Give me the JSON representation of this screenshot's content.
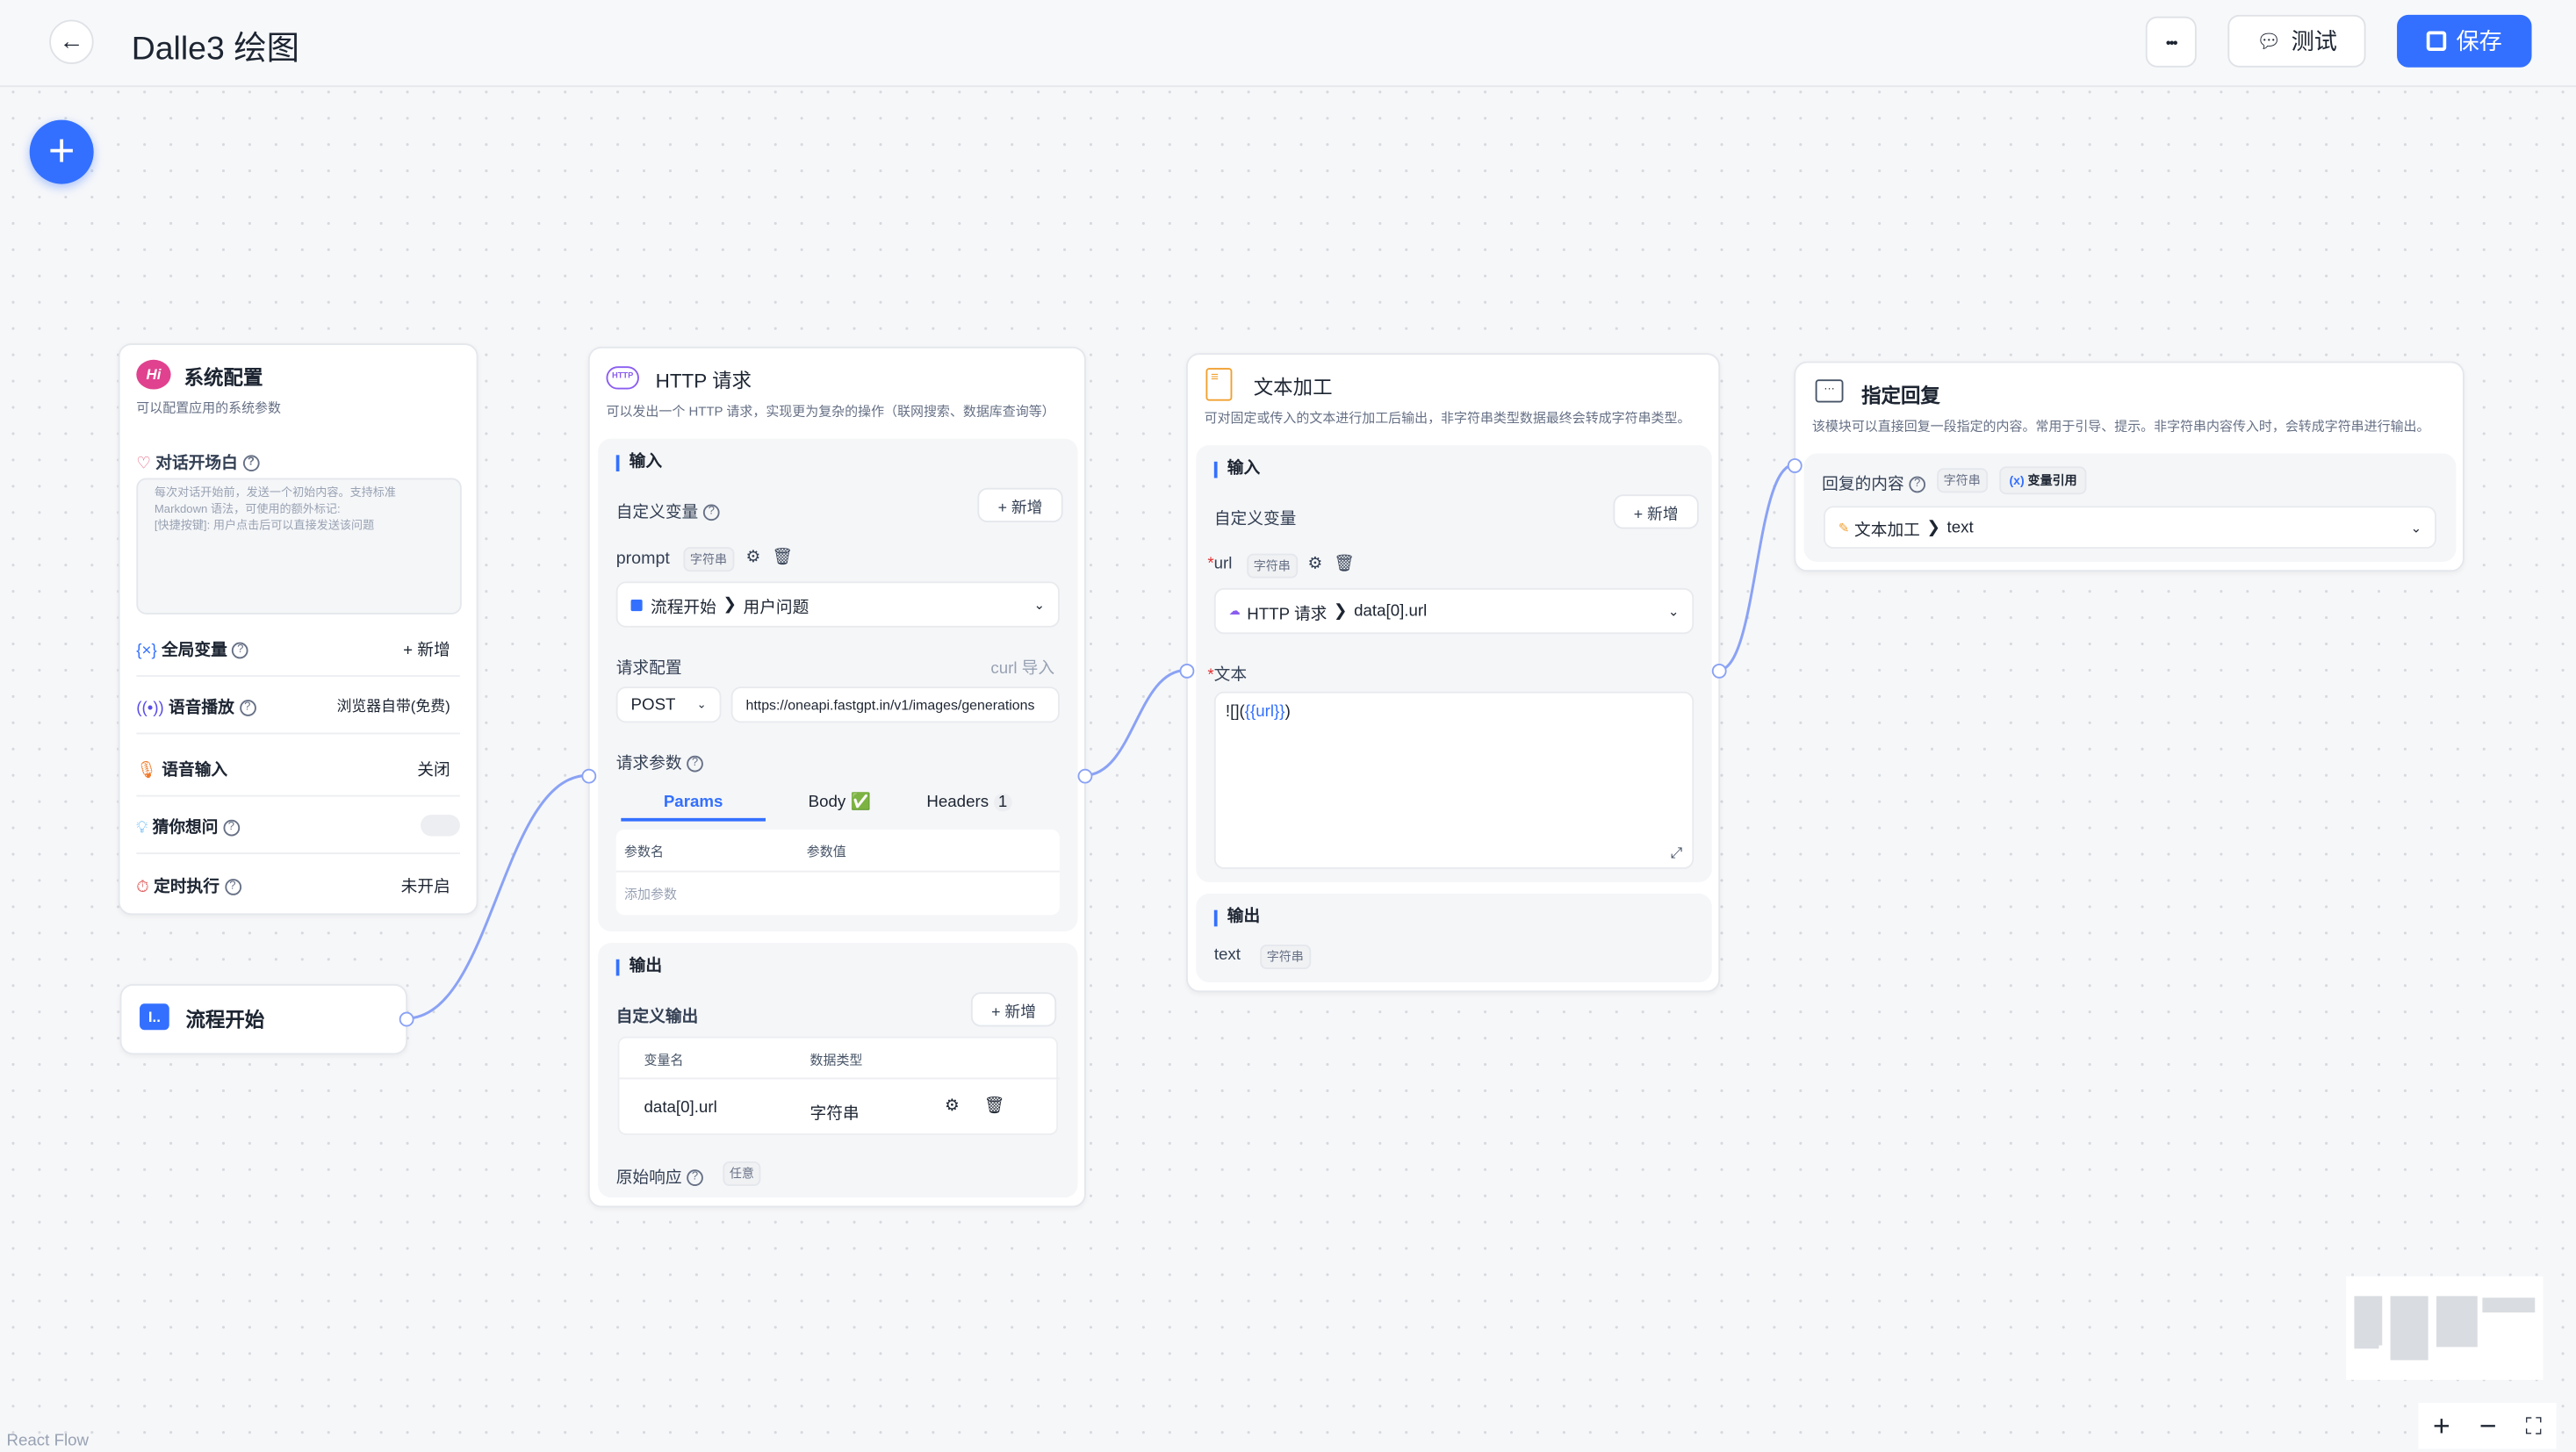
{
  "header": {
    "title": "Dalle3 绘图",
    "more_label": "•••",
    "test_label": "测试",
    "save_label": "保存"
  },
  "colors": {
    "accent": "#3370ff",
    "edge": "#8aa2f5"
  },
  "system_config": {
    "title": "系统配置",
    "desc": "可以配置应用的系统参数",
    "welcome_label": "对话开场白",
    "welcome_placeholder": "每次对话开始前，发送一个初始内容。支持标准 Markdown 语法，可使用的额外标记:\n[快捷按键]: 用户点击后可以直接发送该问题",
    "rows": [
      {
        "icon": "variable-icon",
        "label": "全局变量",
        "value": "+ 新增",
        "help": true
      },
      {
        "icon": "speaker-icon",
        "label": "语音播放",
        "value": "浏览器自带(免费)",
        "help": true
      },
      {
        "icon": "microphone-icon",
        "label": "语音输入",
        "value": "关闭",
        "help": false
      },
      {
        "icon": "lightbulb-icon",
        "label": "猜你想问",
        "value": "",
        "help": true,
        "toggle": false
      },
      {
        "icon": "timer-icon",
        "label": "定时执行",
        "value": "未开启",
        "help": true
      }
    ]
  },
  "flow_start": {
    "title": "流程开始"
  },
  "http": {
    "title": "HTTP 请求",
    "desc": "可以发出一个 HTTP 请求，实现更为复杂的操作（联网搜索、数据库查询等）",
    "input_label": "输入",
    "custom_var_label": "自定义变量",
    "add_label": "+ 新增",
    "var_name": "prompt",
    "var_type": "字符串",
    "var_source": "流程开始",
    "var_source_field": "用户问题",
    "request_config_label": "请求配置",
    "curl_import": "curl 导入",
    "method": "POST",
    "url": "https://oneapi.fastgpt.in/v1/images/generations",
    "params_label": "请求参数",
    "tabs": [
      {
        "label": "Params",
        "active": true
      },
      {
        "label": "Body ✅",
        "active": false
      },
      {
        "label": "Headers",
        "badge": "1",
        "active": false
      }
    ],
    "param_col_name": "参数名",
    "param_col_value": "参数值",
    "add_param": "添加参数",
    "output_label": "输出",
    "custom_output_label": "自定义输出",
    "out_col_name": "变量名",
    "out_col_type": "数据类型",
    "out_name": "data[0].url",
    "out_type": "字符串",
    "raw_response_label": "原始响应",
    "raw_response_type": "任意"
  },
  "text_edit": {
    "title": "文本加工",
    "desc": "可对固定或传入的文本进行加工后输出，非字符串类型数据最终会转成字符串类型。",
    "input_label": "输入",
    "custom_var_label": "自定义变量",
    "add_label": "+ 新增",
    "var_name": "url",
    "var_type": "字符串",
    "var_source": "HTTP 请求",
    "var_source_field": "data[0].url",
    "text_label": "文本",
    "text_prefix": "![](",
    "text_var": "{{url}}",
    "text_suffix": ")",
    "output_label": "输出",
    "out_name": "text",
    "out_type": "字符串"
  },
  "reply": {
    "title": "指定回复",
    "desc": "该模块可以直接回复一段指定的内容。常用于引导、提示。非字符串内容传入时，会转成字符串进行输出。",
    "content_label": "回复的内容",
    "content_type": "字符串",
    "var_ref_label": "变量引用",
    "source": "文本加工",
    "source_field": "text"
  },
  "footer": {
    "attribution": "React Flow",
    "zoom_in": "+",
    "zoom_out": "−",
    "fit": "⛶"
  }
}
